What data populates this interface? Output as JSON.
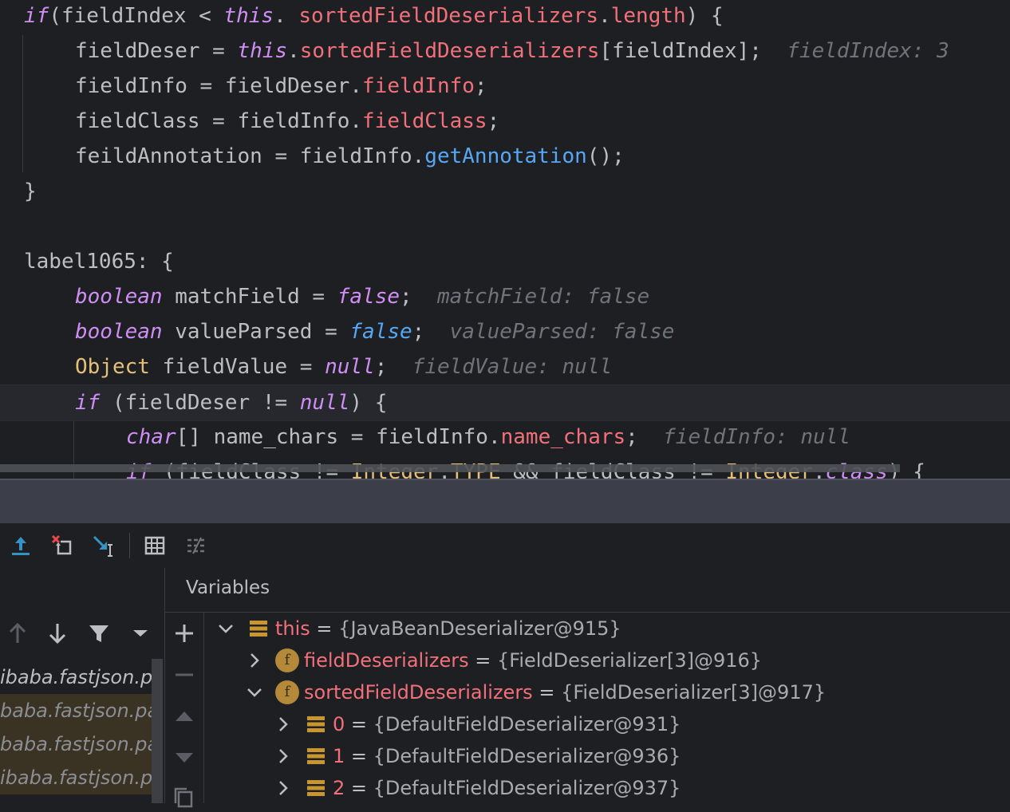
{
  "editor": {
    "lines": [
      {
        "parts": [
          [
            "kw",
            "if"
          ],
          [
            "",
            "(fieldIndex < "
          ],
          [
            "kw",
            "this"
          ],
          [
            "",
            ". "
          ],
          [
            "fld",
            "sortedFieldDeserializers"
          ],
          [
            "",
            "."
          ],
          [
            "fld",
            "length"
          ],
          [
            "",
            ") {"
          ]
        ]
      },
      {
        "parts": [
          [
            "",
            "fieldDeser = "
          ],
          [
            "kw",
            "this"
          ],
          [
            "",
            "."
          ],
          [
            "fld",
            "sortedFieldDeserializers"
          ],
          [
            "",
            "[fieldIndex];  "
          ],
          [
            "hint",
            "fieldIndex: 3"
          ]
        ]
      },
      {
        "parts": [
          [
            "",
            "fieldInfo = fieldDeser."
          ],
          [
            "fld",
            "fieldInfo"
          ],
          [
            "",
            ";"
          ]
        ]
      },
      {
        "parts": [
          [
            "",
            "fieldClass = fieldInfo."
          ],
          [
            "fld",
            "fieldClass"
          ],
          [
            "",
            ";"
          ]
        ]
      },
      {
        "parts": [
          [
            "",
            "feildAnnotation = fieldInfo."
          ],
          [
            "mth",
            "getAnnotation"
          ],
          [
            "",
            "();"
          ]
        ]
      },
      {
        "parts": [
          [
            "",
            "}"
          ]
        ]
      },
      {
        "parts": []
      },
      {
        "parts": [
          [
            "",
            "label1065: {"
          ]
        ]
      },
      {
        "parts": [
          [
            "kw",
            "boolean"
          ],
          [
            "",
            " matchField = "
          ],
          [
            "kw",
            "false"
          ],
          [
            "",
            ";  "
          ],
          [
            "hint",
            "matchField: false"
          ]
        ]
      },
      {
        "parts": [
          [
            "kw",
            "boolean"
          ],
          [
            "",
            " valueParsed = "
          ],
          [
            "lit",
            "false"
          ],
          [
            "",
            ";  "
          ],
          [
            "hint",
            "valueParsed: false"
          ]
        ]
      },
      {
        "parts": [
          [
            "cls",
            "Object"
          ],
          [
            "",
            " fieldValue = "
          ],
          [
            "kw",
            "null"
          ],
          [
            "",
            ";  "
          ],
          [
            "hint",
            "fieldValue: null"
          ]
        ]
      },
      {
        "parts": [
          [
            "kw",
            "if"
          ],
          [
            "",
            " (fieldDeser != "
          ],
          [
            "kw",
            "null"
          ],
          [
            "",
            ") {"
          ]
        ]
      },
      {
        "parts": [
          [
            "kw",
            "char"
          ],
          [
            "",
            "[] name_chars = fieldInfo."
          ],
          [
            "fld",
            "name_chars"
          ],
          [
            "",
            ";  "
          ],
          [
            "hint",
            "fieldInfo: null"
          ]
        ]
      },
      {
        "parts": [
          [
            "kw",
            "if"
          ],
          [
            "",
            " (fieldClass != "
          ],
          [
            "cls",
            "Integer"
          ],
          [
            "",
            "."
          ],
          [
            "cls",
            "TYPE"
          ],
          [
            "",
            " && fieldClass != "
          ],
          [
            "cls",
            "Integer"
          ],
          [
            "",
            "."
          ],
          [
            "kw",
            "class"
          ],
          [
            "",
            ") {"
          ]
        ]
      }
    ]
  },
  "variables": {
    "title": "Variables",
    "rows": [
      {
        "name": "this",
        "value": "{JavaBeanDeserializer@915}",
        "expanded": true
      },
      {
        "name": "fieldDeserializers",
        "value": "{FieldDeserializer[3]@916}",
        "expanded": false
      },
      {
        "name": "sortedFieldDeserializers",
        "value": "{FieldDeserializer[3]@917}",
        "expanded": true
      },
      {
        "name": "0",
        "value": "{DefaultFieldDeserializer@931}",
        "expanded": false
      },
      {
        "name": "1",
        "value": "{DefaultFieldDeserializer@936}",
        "expanded": false
      },
      {
        "name": "2",
        "value": "{DefaultFieldDeserializer@937}",
        "expanded": false
      }
    ]
  },
  "frames": {
    "items": [
      "ibaba.fastjson.pars",
      "baba.fastjson.pars",
      "baba.fastjson.pars",
      "ibaba.fastjson.pars"
    ]
  },
  "toolbar": {
    "icons": [
      "step-out-icon",
      "drop-frame-icon",
      "run-to-cursor-icon",
      "evaluate-table-icon",
      "trace-icon"
    ]
  },
  "colors": {
    "editor_bg": "#1e1f22",
    "keyword": "#cf8ef4",
    "field": "#f2707a",
    "method": "#56a8f5",
    "hint": "#6f737a"
  }
}
